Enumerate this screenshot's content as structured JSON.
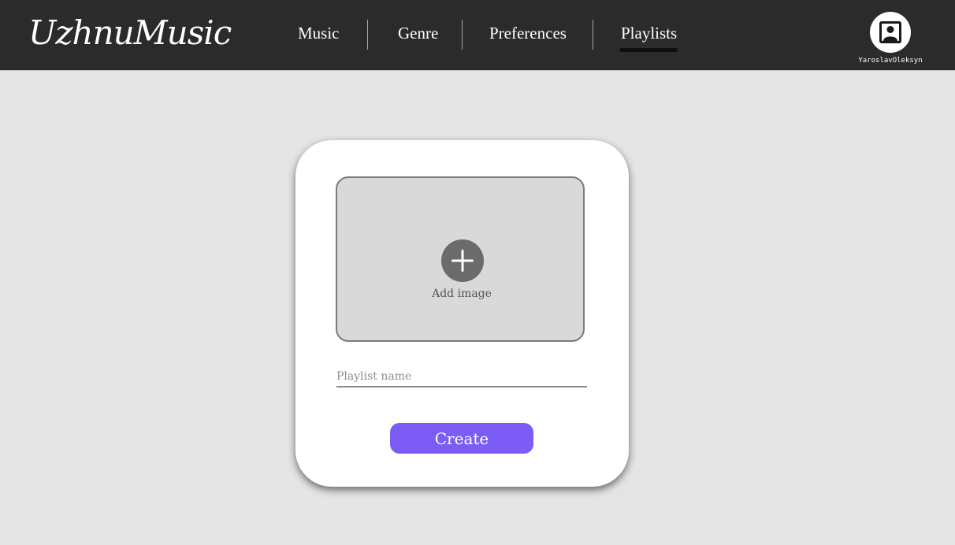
{
  "app": {
    "logo_text": "UzhnuMusic"
  },
  "nav": {
    "items": [
      {
        "label": "Music"
      },
      {
        "label": "Genre"
      },
      {
        "label": "Preferences"
      },
      {
        "label": "Playlists",
        "active": true
      }
    ]
  },
  "user": {
    "username": "YaroslavOleksyn",
    "avatar_icon": "user-portrait-icon"
  },
  "create_playlist": {
    "add_image_label": "Add image",
    "add_image_icon": "plus-circle-icon",
    "name_placeholder": "Playlist name",
    "name_value": "",
    "create_label": "Create"
  },
  "colors": {
    "topbar": "#2b2b2b",
    "background": "#e5e5e5",
    "accent": "#7b5cf5",
    "image_box": "#d9d9d9"
  }
}
